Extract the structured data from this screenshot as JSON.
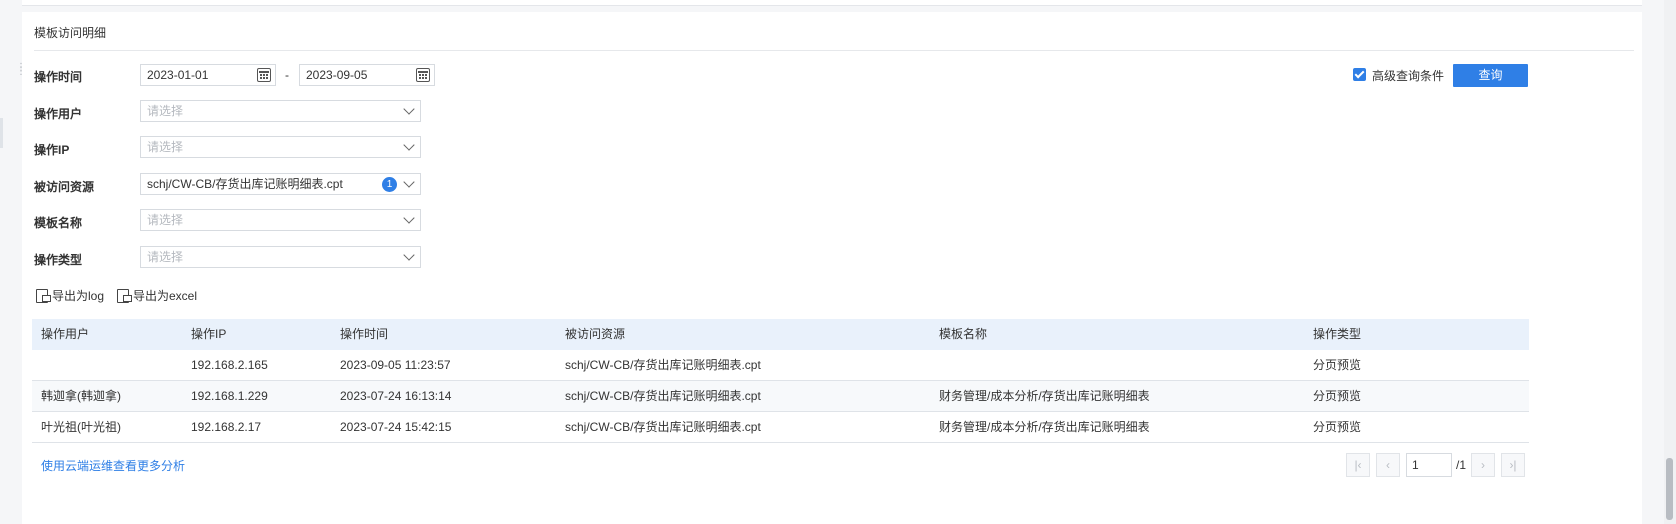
{
  "panel": {
    "title": "模板访问明细"
  },
  "filters": {
    "operation_time": {
      "label": "操作时间",
      "start": "2023-01-01",
      "separator": "-",
      "end": "2023-09-05"
    },
    "operation_user": {
      "label": "操作用户",
      "placeholder": "请选择"
    },
    "operation_ip": {
      "label": "操作IP",
      "placeholder": "请选择"
    },
    "visited_resource": {
      "label": "被访问资源",
      "value": "schj/CW-CB/存货出库记账明细表.cpt",
      "selected_count": "1"
    },
    "template_name": {
      "label": "模板名称",
      "placeholder": "请选择"
    },
    "operation_type": {
      "label": "操作类型",
      "placeholder": "请选择"
    }
  },
  "advanced": {
    "label": "高级查询条件",
    "checked": true
  },
  "query_button": "查询",
  "export": {
    "log": "导出为log",
    "excel": "导出为excel"
  },
  "table": {
    "columns": [
      "操作用户",
      "操作IP",
      "操作时间",
      "被访问资源",
      "模板名称",
      "操作类型"
    ],
    "rows": [
      [
        "",
        "192.168.2.165",
        "2023-09-05 11:23:57",
        "schj/CW-CB/存货出库记账明细表.cpt",
        "",
        "分页预览"
      ],
      [
        "韩迦拿(韩迦拿)",
        "192.168.1.229",
        "2023-07-24 16:13:14",
        "schj/CW-CB/存货出库记账明细表.cpt",
        "财务管理/成本分析/存货出库记账明细表",
        "分页预览"
      ],
      [
        "叶光祖(叶光祖)",
        "192.168.2.17",
        "2023-07-24 15:42:15",
        "schj/CW-CB/存货出库记账明细表.cpt",
        "财务管理/成本分析/存货出库记账明细表",
        "分页预览"
      ]
    ]
  },
  "footer": {
    "more_link": "使用云端运维查看更多分析"
  },
  "pagination": {
    "current": "1",
    "total": "/1"
  },
  "icons": {
    "calendar": "calendar-icon",
    "chevron": "chevron-down-icon",
    "export": "export-file-icon",
    "first": "first-page-icon",
    "prev": "prev-page-icon",
    "next": "next-page-icon",
    "last": "last-page-icon"
  },
  "colors": {
    "accent": "#2f7fe6",
    "table_header_bg": "#e9f1fb",
    "placeholder": "#b5b9bf"
  }
}
